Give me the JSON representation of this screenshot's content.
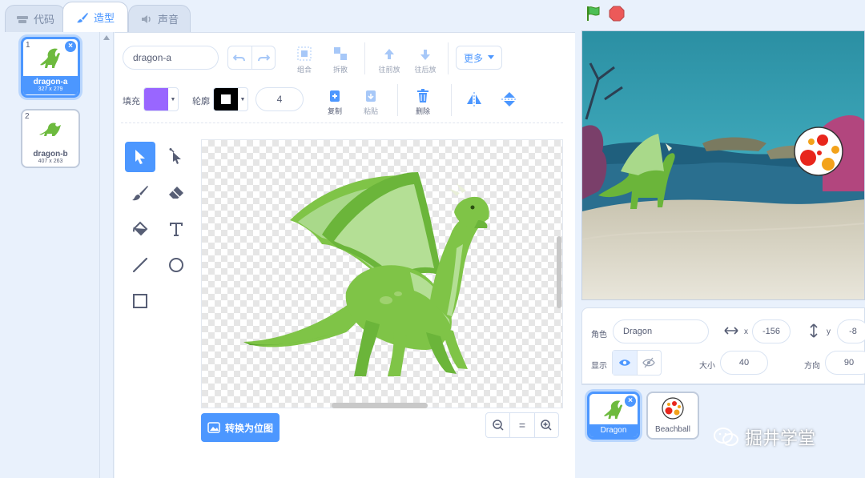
{
  "tabs": [
    {
      "label": "代码",
      "icon": "code-icon"
    },
    {
      "label": "造型",
      "icon": "brush-icon"
    },
    {
      "label": "声音",
      "icon": "speaker-icon"
    }
  ],
  "costumes": [
    {
      "number": "1",
      "name": "dragon-a",
      "size": "327 x 279"
    },
    {
      "number": "2",
      "name": "dragon-b",
      "size": "407 x 263"
    }
  ],
  "editor": {
    "costume_name": "dragon-a",
    "group_label": "组合",
    "ungroup_label": "拆散",
    "forward_label": "往前放",
    "backward_label": "往后放",
    "more_label": "更多",
    "fill_label": "填充",
    "outline_label": "轮廓",
    "outline_width": "4",
    "copy_label": "复制",
    "paste_label": "粘贴",
    "delete_label": "删除",
    "bitmap_label": "转换为位图",
    "zoom_reset_label": "=",
    "colors": {
      "fill": "#9966ff",
      "outline": "#000000",
      "accent": "#4c97ff"
    }
  },
  "sprite_info": {
    "sprite_label": "角色",
    "sprite_name": "Dragon",
    "x_label": "x",
    "x_value": "-156",
    "y_label": "y",
    "y_value": "-8",
    "show_label": "显示",
    "size_label": "大小",
    "size_value": "40",
    "direction_label": "方向",
    "direction_value": "90"
  },
  "sprites": [
    {
      "name": "Dragon"
    },
    {
      "name": "Beachball"
    }
  ],
  "watermark": "掘井学堂"
}
